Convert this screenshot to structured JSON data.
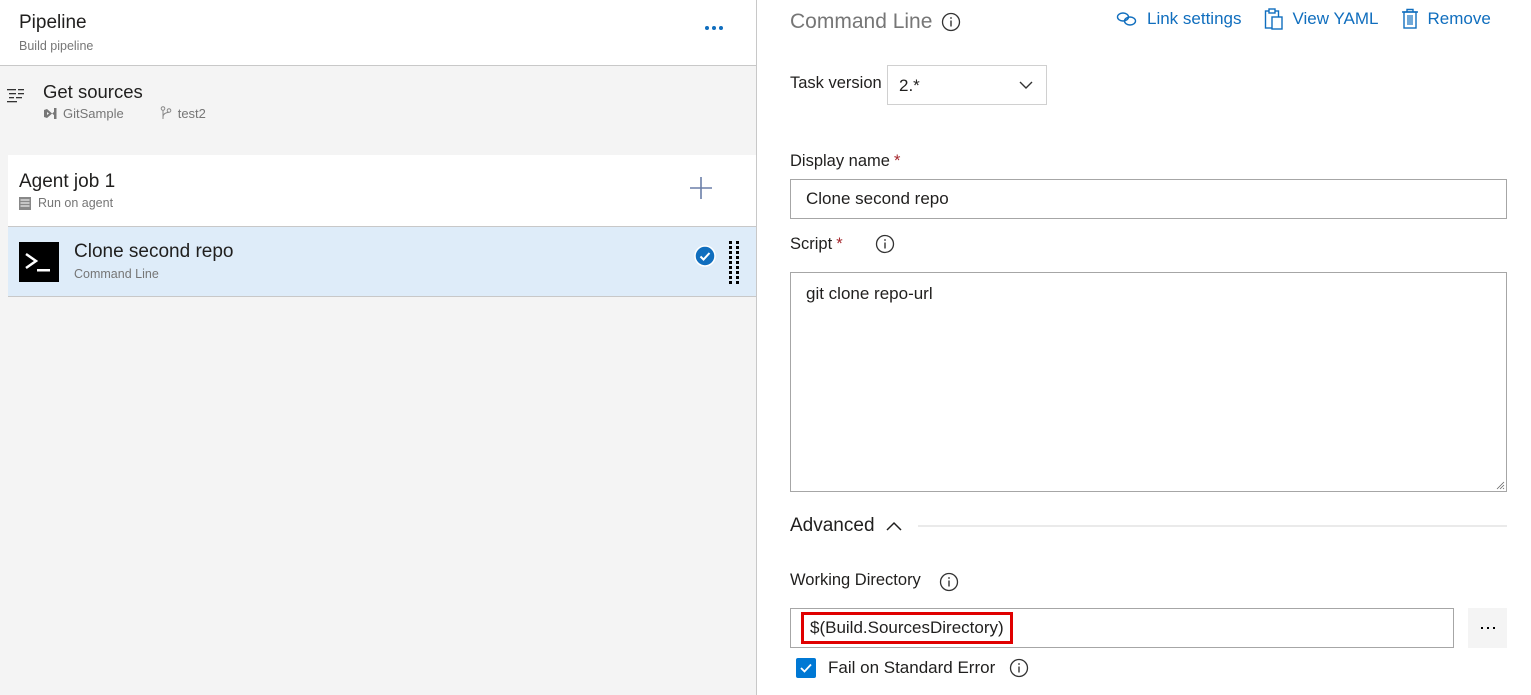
{
  "pipeline": {
    "title": "Pipeline",
    "subtitle": "Build pipeline",
    "more_icon": "ellipsis-icon"
  },
  "get_sources": {
    "title": "Get sources",
    "repo": "GitSample",
    "branch": "test2"
  },
  "agent_job": {
    "title": "Agent job 1",
    "subtitle": "Run on agent"
  },
  "task": {
    "title": "Clone second repo",
    "subtitle": "Command Line",
    "selected": true
  },
  "panel": {
    "title": "Command Line",
    "actions": [
      {
        "label": "Link settings",
        "icon": "link-icon"
      },
      {
        "label": "View YAML",
        "icon": "clipboard-icon"
      },
      {
        "label": "Remove",
        "icon": "trash-icon"
      }
    ],
    "task_version": {
      "label": "Task version",
      "value": "2.*"
    },
    "display_name": {
      "label": "Display name",
      "required_mark": "*",
      "value": "Clone second repo"
    },
    "script": {
      "label": "Script",
      "required_mark": "*",
      "value": "git clone repo-url"
    },
    "advanced": {
      "label": "Advanced",
      "expanded": true
    },
    "working_directory": {
      "label": "Working Directory",
      "value": "$(Build.SourcesDirectory)"
    },
    "fail_on_stderr": {
      "label": "Fail on Standard Error",
      "checked": true
    }
  },
  "colors": {
    "accent": "#106ebe",
    "selected_row": "#deecf9",
    "highlight_box": "#e00000",
    "required": "#a4262c"
  }
}
